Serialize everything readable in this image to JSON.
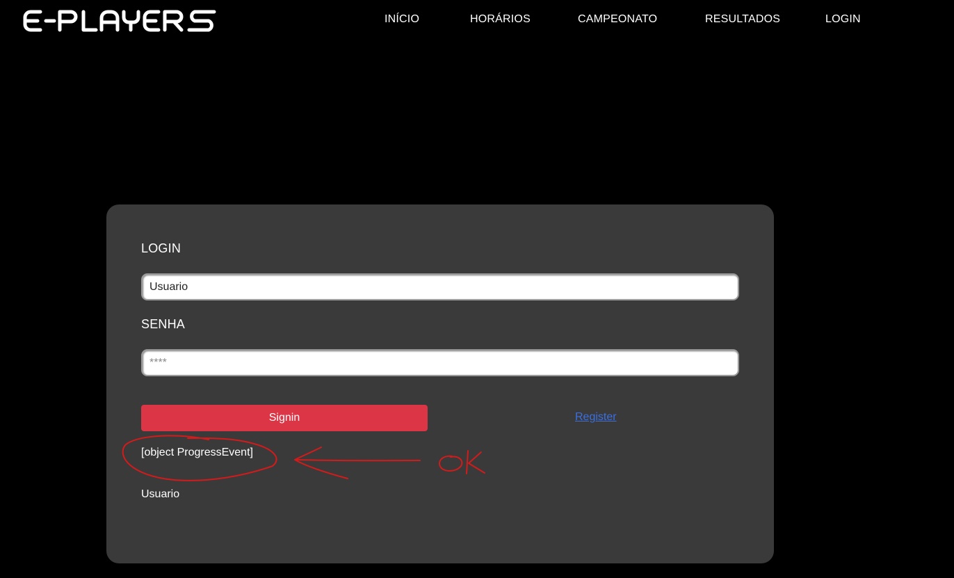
{
  "header": {
    "logo_text": "E-PLAYERS",
    "nav": [
      {
        "label": "INÍCIO"
      },
      {
        "label": "HORÁRIOS"
      },
      {
        "label": "CAMPEONATO"
      },
      {
        "label": "RESULTADOS"
      },
      {
        "label": "LOGIN"
      }
    ]
  },
  "login_form": {
    "login_label": "LOGIN",
    "username_value": "Usuario",
    "password_label": "SENHA",
    "password_placeholder": "****",
    "signin_label": "Signin",
    "register_label": "Register",
    "result_text": "[object ProgressEvent]",
    "user_text": "Usuario"
  },
  "annotation": {
    "text": "OK",
    "color": "#d41b1b"
  },
  "colors": {
    "background": "#000000",
    "card": "#3a3a3a",
    "signin_button": "#dc3545",
    "link": "#3a6fe0"
  }
}
